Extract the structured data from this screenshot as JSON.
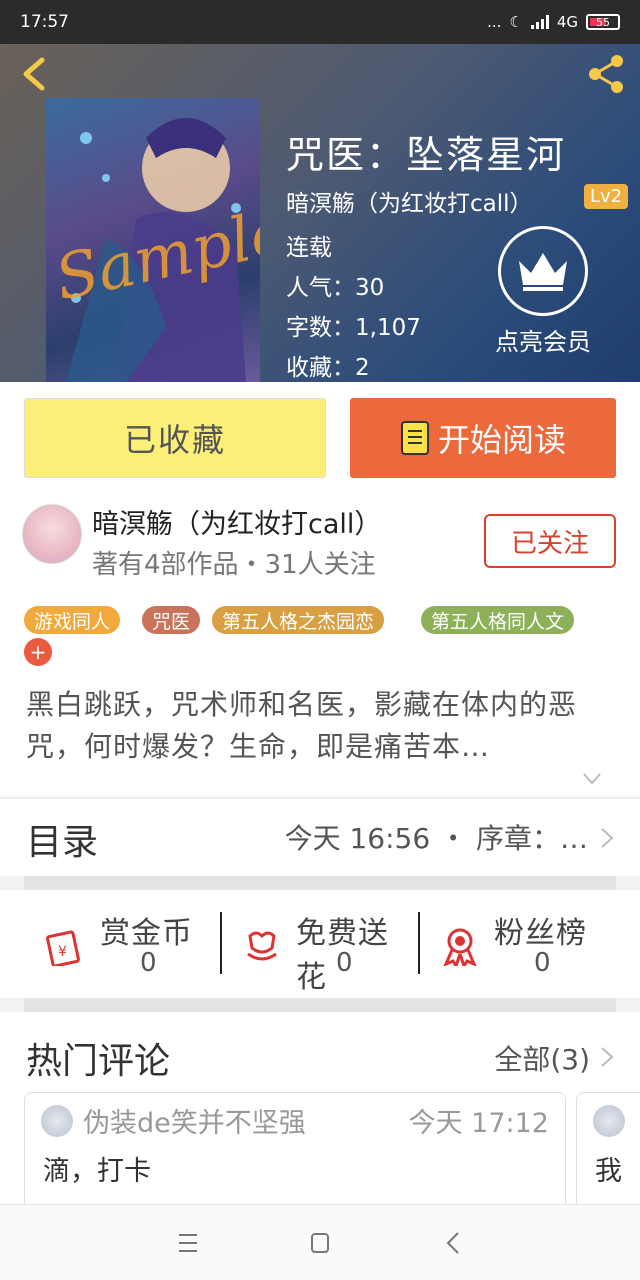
{
  "status_bar": {
    "time": "17:57",
    "network": "4G",
    "battery": "55",
    "dots": "..."
  },
  "book": {
    "title": "咒医：坠落星河",
    "author": "暗溟觞（为红妆打call）",
    "author_level": "Lv2",
    "status": "连载",
    "popularity_label": "人气：",
    "popularity": "30",
    "words_label": "字数：",
    "words": "1,107",
    "favorites_label": "收藏：",
    "favorites": "2",
    "cover_watermark": "Sample",
    "vip_label": "点亮会员"
  },
  "actions": {
    "favorited_label": "已收藏",
    "read_label": "开始阅读"
  },
  "author_card": {
    "name": "暗溟觞（为红妆打call）",
    "subtitle": "著有4部作品・31人关注",
    "follow_label": "已关注"
  },
  "tags": [
    {
      "label": "游戏同人",
      "color": "#f2a93b"
    },
    {
      "label": "咒医",
      "color": "#c8735a"
    },
    {
      "label": "第五人格之杰园恋",
      "color": "#d9a043"
    },
    {
      "label": "第五人格同人文",
      "color": "#8db058"
    }
  ],
  "add_tag_label": "+",
  "description": "黑白跳跃，咒术师和名医，影藏在体内的恶咒，何时爆发？生命，即是痛苦本…",
  "toc": {
    "label": "目录",
    "latest": "今天 16:56 ・ 序章：…"
  },
  "stats": [
    {
      "name": "赏金币",
      "value": "0",
      "icon": "red-envelope-icon"
    },
    {
      "name": "免费送花",
      "value": "0",
      "icon": "flower-icon"
    },
    {
      "name": "粉丝榜",
      "value": "0",
      "icon": "award-ribbon-icon"
    }
  ],
  "comments": {
    "title": "热门评论",
    "all_label": "全部(3)",
    "items": [
      {
        "user": "伪装de笑并不坚强",
        "time": "今天 17:12",
        "text": "滴，打卡"
      },
      {
        "user": "",
        "time": "",
        "text": "我"
      }
    ]
  },
  "colors": {
    "accent": "#ec693c",
    "follow": "#d9412e",
    "favorite_bg": "#fbef7a",
    "lv_badge": "#f0b040"
  }
}
